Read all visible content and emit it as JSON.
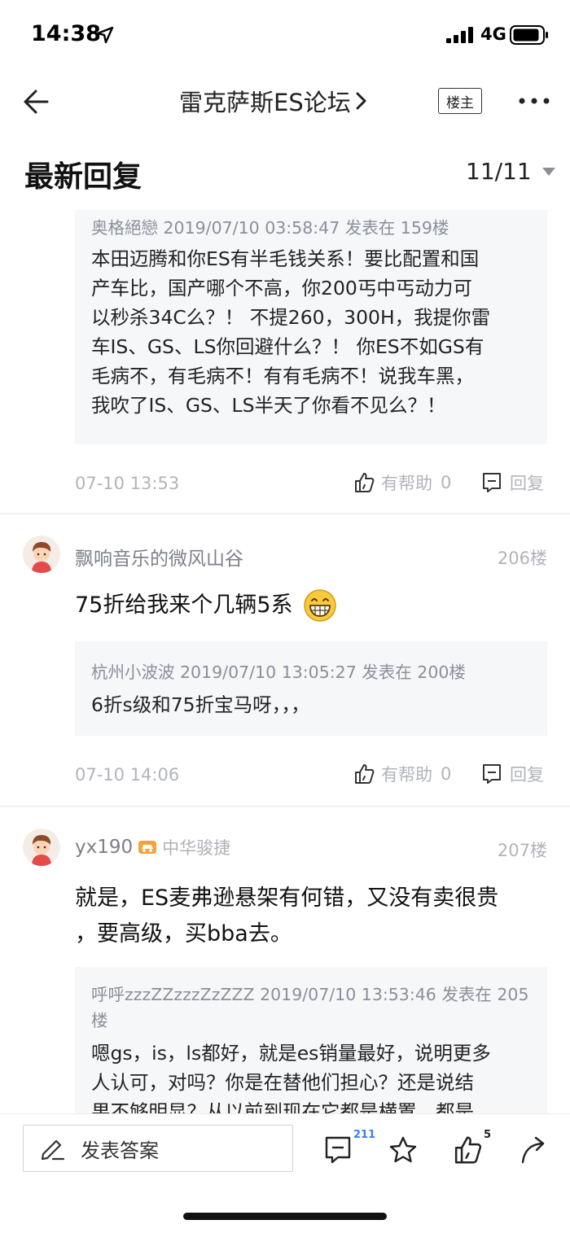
{
  "status_bar": {
    "time": "14:38",
    "network": "4G"
  },
  "nav": {
    "title": "雷克萨斯ES论坛",
    "owner_label": "楼主"
  },
  "section": {
    "title": "最新回复",
    "page": "11/11"
  },
  "posts": [
    {
      "quote": {
        "meta": "奥格絕戀 2019/07/10 03:58:47 发表在 159楼",
        "lines": [
          "本田迈腾和你ES有半毛钱关系！要比配置和国",
          "产车比，国产哪个不高，你200丐中丐动力可",
          "以秒杀34C么？！ 不提260，300H，我提你雷",
          "车IS、GS、LS你回避什么？！ 你ES不如GS有",
          "毛病不，有毛病不！有有毛病不！说我车黑，",
          "我吹了IS、GS、LS半天了你看不见么？！"
        ]
      },
      "date": "07-10 13:53",
      "helpful_label": "有帮助",
      "helpful_count": "0",
      "reply_label": "回复"
    },
    {
      "username": "飘响音乐的微风山谷",
      "floor": "206楼",
      "text": "75折给我来个几辆5系",
      "quote": {
        "meta": "杭州小波波 2019/07/10 13:05:27 发表在 200楼",
        "lines": [
          "6折s级和75折宝马呀，，，"
        ]
      },
      "date": "07-10 14:06",
      "helpful_label": "有帮助",
      "helpful_count": "0",
      "reply_label": "回复"
    },
    {
      "username": "yx190",
      "car_name": "中华骏捷",
      "floor": "207楼",
      "text_lines": [
        "就是，ES麦弗逊悬架有何错，又没有卖很贵",
        "，要高级，买bba去。"
      ],
      "quote": {
        "meta_lines": [
          "呼呼zzzZZzzzZzZZZ 2019/07/10 13:53:46 发表在 205",
          "楼"
        ],
        "lines": [
          "嗯gs，is，ls都好，就是es销量最好，说明更多",
          "人认可，对吗？你是在替他们担心？还是说结",
          "果不够明显？从以前到现在它都是横置，都是"
        ]
      }
    }
  ],
  "bottom_bar": {
    "compose_label": "发表答案",
    "comment_count": "211",
    "like_count": "5"
  }
}
